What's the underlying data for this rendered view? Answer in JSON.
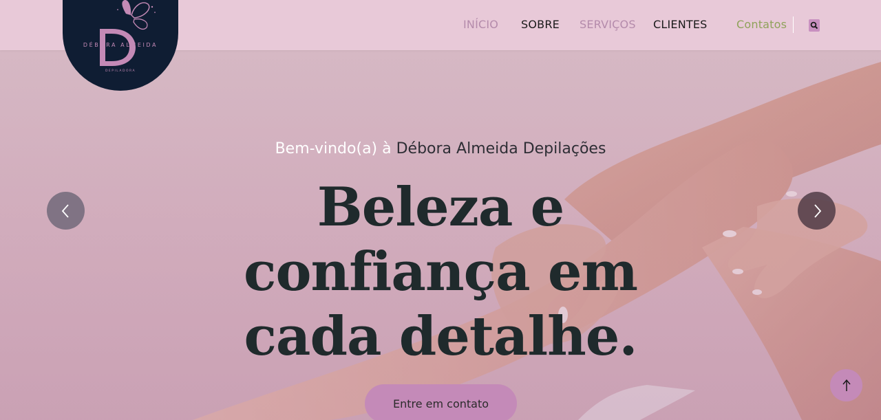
{
  "brand": {
    "name": "DÉBORA ALMEIDA",
    "subtitle": "DEPILADORA",
    "monogram": "D"
  },
  "nav": {
    "items": [
      {
        "label": "INÍCIO"
      },
      {
        "label": "SOBRE"
      },
      {
        "label": "SERVIÇOS"
      },
      {
        "label": "CLIENTES"
      },
      {
        "label": "Contatos"
      }
    ],
    "search_icon": "search-icon"
  },
  "hero": {
    "welcome_prefix": "Bem-vindo(a) à",
    "welcome_name": "Débora Almeida Depilações",
    "headline_lines": [
      "Beleza e",
      "confiança em",
      "cada detalhe."
    ],
    "cta_label": "Entre em contato"
  },
  "icons": {
    "prev": "chevron-left-icon",
    "next": "chevron-right-icon",
    "scroll_top": "arrow-up-icon",
    "logo_ornament": "butterfly-icon"
  },
  "colors": {
    "header_bg": "#e8c9d8",
    "logo_bg": "#0f1d33",
    "accent_pink": "#c48ab8",
    "nav_active": "#b48bab",
    "nav_contact": "#8fa25a",
    "headline": "#1f2a2c"
  }
}
